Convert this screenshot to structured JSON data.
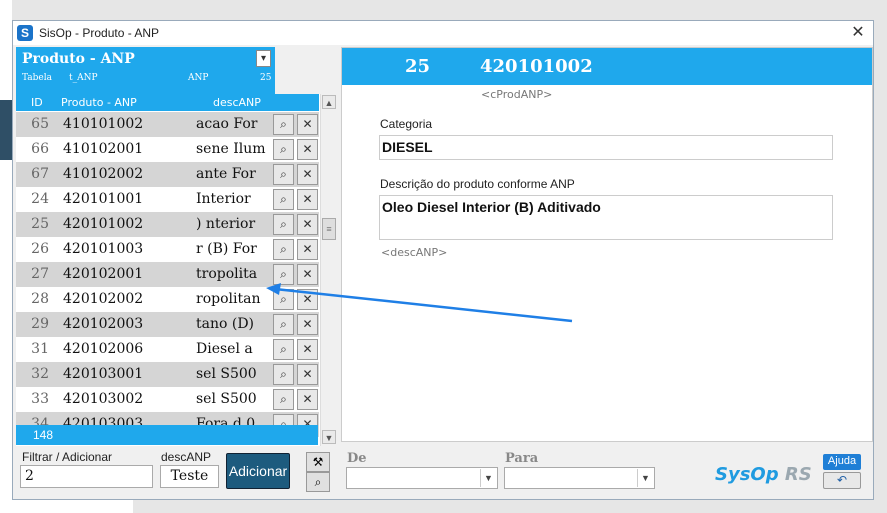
{
  "window": {
    "title": "SisOp - Produto - ANP",
    "close": "✕"
  },
  "list": {
    "title": "Produto - ANP",
    "table_label": "Tabela",
    "table_name": "t_ANP",
    "anp_label": "ANP",
    "anp_value": "25",
    "headers": {
      "id": "ID",
      "produto": "Produto - ANP",
      "desc": "descANP"
    },
    "rows": [
      {
        "id": "65",
        "prod": "410101002",
        "desc": "acao For"
      },
      {
        "id": "66",
        "prod": "410102001",
        "desc": "sene Ilum"
      },
      {
        "id": "67",
        "prod": "410102002",
        "desc": "ante For"
      },
      {
        "id": "24",
        "prod": "420101001",
        "desc": "Interior"
      },
      {
        "id": "25",
        "prod": "420101002",
        "desc": "nterior ("
      },
      {
        "id": "26",
        "prod": "420101003",
        "desc": "r (B) For"
      },
      {
        "id": "27",
        "prod": "420102001",
        "desc": "tropolita"
      },
      {
        "id": "28",
        "prod": "420102002",
        "desc": "ropolitan"
      },
      {
        "id": "29",
        "prod": "420102003",
        "desc": "tano (D)"
      },
      {
        "id": "31",
        "prod": "420102006",
        "desc": "Diesel a"
      },
      {
        "id": "32",
        "prod": "420103001",
        "desc": "sel S500"
      },
      {
        "id": "33",
        "prod": "420103002",
        "desc": "sel S500"
      },
      {
        "id": "34",
        "prod": "420103003",
        "desc": "0 Fora d"
      }
    ],
    "count": "148"
  },
  "detail": {
    "id": "25",
    "code": "420101002",
    "code_tag": "<cProdANP>",
    "categoria_label": "Categoria",
    "categoria_value": "DIESEL",
    "descricao_label": "Descrição do produto conforme ANP",
    "descricao_value": "Oleo Diesel Interior (B) Aditivado",
    "desc_tag": "<descANP>"
  },
  "bottom": {
    "filter_label": "Filtrar / Adicionar",
    "filter_value": "2",
    "desc_label": "descANP",
    "desc_value": "Teste",
    "add_button": "Adicionar",
    "de_label": "De",
    "para_label": "Para",
    "brand": "SysOp",
    "brand_suffix": "RS",
    "help_button": "Ajuda"
  },
  "colors": {
    "header_blue": "#1fa8ec",
    "row_alt": "#d5d5d5",
    "button_dark": "#1d5b7e",
    "annotation_arrow": "#1f7fe6"
  },
  "icons": [
    "app-icon",
    "close-icon",
    "dropdown-arrow-icon",
    "search-document-icon",
    "delete-x-icon",
    "tools-icon",
    "search-icon",
    "undo-icon",
    "scroll-up-icon",
    "scroll-down-icon"
  ]
}
